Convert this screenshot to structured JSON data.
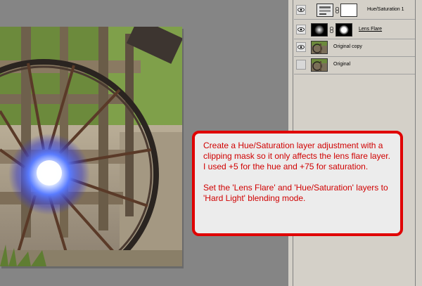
{
  "layers": [
    {
      "name": "Hue/Saturation 1",
      "visible": true,
      "type": "adjustment",
      "linked_mask": true,
      "underline": false
    },
    {
      "name": "Lens Flare",
      "visible": true,
      "type": "image-with-mask",
      "linked_mask": true,
      "underline": true
    },
    {
      "name": "Original copy",
      "visible": true,
      "type": "image",
      "linked_mask": false,
      "underline": false
    },
    {
      "name": "Original",
      "visible": false,
      "type": "image",
      "linked_mask": false,
      "underline": false
    }
  ],
  "callout": {
    "paragraph1": "Create a Hue/Saturation layer adjustment with a clipping mask so it only affects the lens flare layer. I used +5 for the hue and +75 for saturation.",
    "paragraph2": "Set the 'Lens Flare' and 'Hue/Saturation' layers to 'Hard Light' blending mode."
  },
  "colors": {
    "callout_border": "#e00000",
    "callout_text": "#d00000",
    "panel_bg": "#d4d0c8",
    "canvas_bg": "#858585",
    "flare": "#4060ff"
  },
  "icons": {
    "visibility": "eye-icon",
    "link": "chain-link-icon"
  }
}
